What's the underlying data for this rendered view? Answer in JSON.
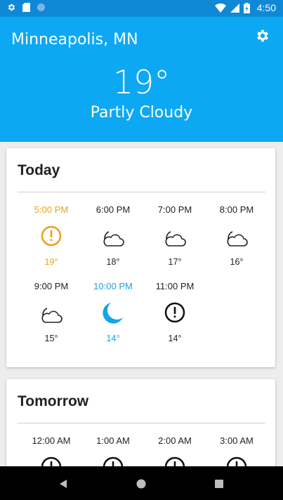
{
  "status": {
    "time": "4:50"
  },
  "header": {
    "city": "Minneapolis, MN",
    "temperature": "19°",
    "condition": "Partly Cloudy"
  },
  "today": {
    "title": "Today",
    "hours": [
      {
        "time": "5:00 PM",
        "temp": "19°",
        "icon": "alert-icon",
        "highlight": "orange"
      },
      {
        "time": "6:00 PM",
        "temp": "18°",
        "icon": "cloudy-night-icon"
      },
      {
        "time": "7:00 PM",
        "temp": "17°",
        "icon": "cloudy-night-icon"
      },
      {
        "time": "8:00 PM",
        "temp": "16°",
        "icon": "cloudy-night-icon"
      },
      {
        "time": "9:00 PM",
        "temp": "15°",
        "icon": "cloudy-night-icon"
      },
      {
        "time": "10:00 PM",
        "temp": "14°",
        "icon": "moon-icon",
        "highlight": "blue"
      },
      {
        "time": "11:00 PM",
        "temp": "14°",
        "icon": "alert-icon"
      }
    ]
  },
  "tomorrow": {
    "title": "Tomorrow",
    "hours": [
      {
        "time": "12:00 AM",
        "icon": "alert-icon"
      },
      {
        "time": "1:00 AM",
        "icon": "alert-icon"
      },
      {
        "time": "2:00 AM",
        "icon": "alert-icon"
      },
      {
        "time": "3:00 AM",
        "icon": "alert-icon"
      }
    ]
  },
  "colors": {
    "header_bg": "#0da8f4",
    "status_bg": "#0f89d6",
    "orange": "#ef9e18",
    "blue": "#13a3e8"
  }
}
